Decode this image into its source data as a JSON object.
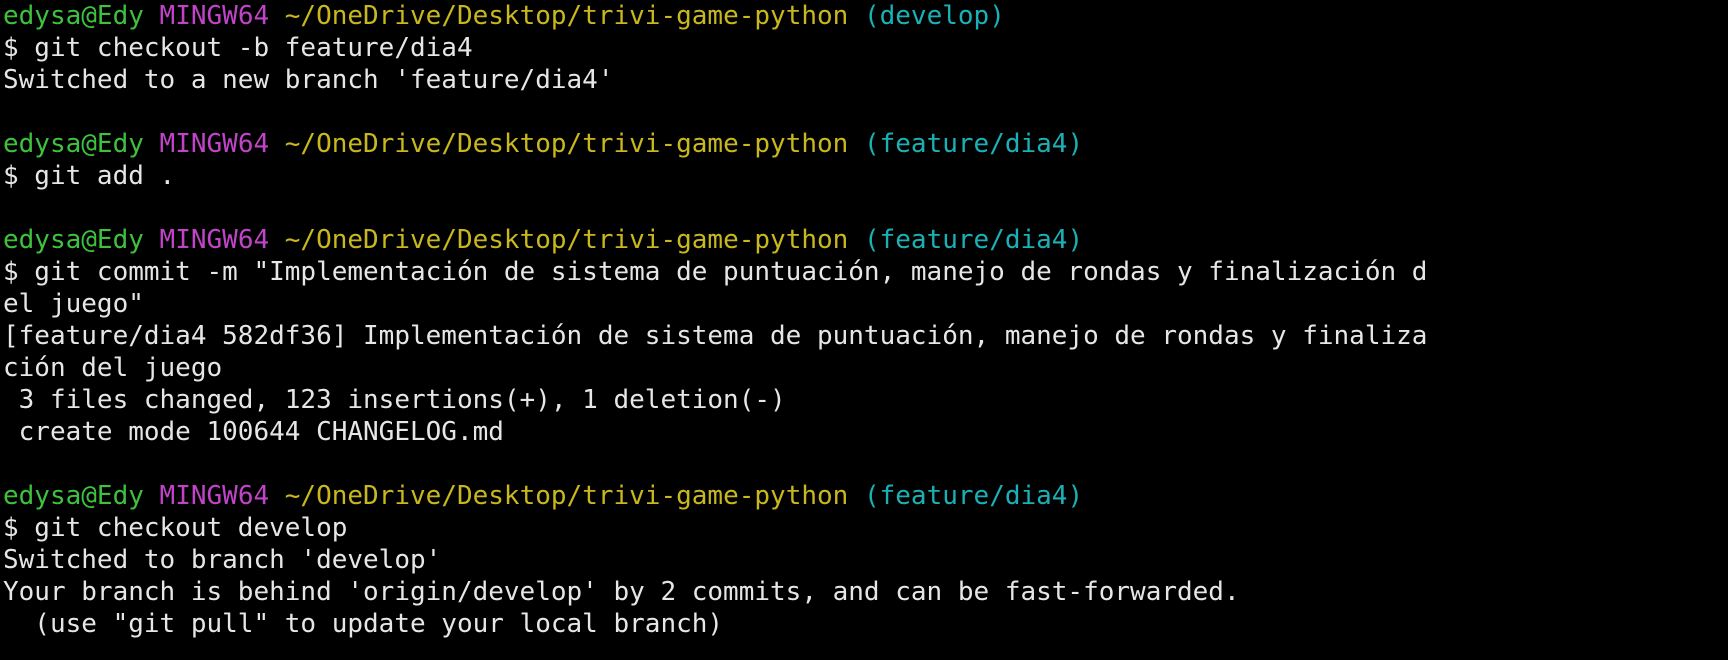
{
  "colors": {
    "background": "#000000",
    "text": "#e6e6e6",
    "user": "#3ec23e",
    "host": "#c044c8",
    "path": "#c8b81e",
    "branch": "#1ab1b6"
  },
  "blocks": [
    {
      "prompt": {
        "user": "edysa@Edy",
        "host": "MINGW64",
        "path": "~/OneDrive/Desktop/trivi-game-python",
        "branch": "(develop)"
      },
      "lines": [
        "$ git checkout -b feature/dia4",
        "Switched to a new branch 'feature/dia4'",
        ""
      ]
    },
    {
      "prompt": {
        "user": "edysa@Edy",
        "host": "MINGW64",
        "path": "~/OneDrive/Desktop/trivi-game-python",
        "branch": "(feature/dia4)"
      },
      "lines": [
        "$ git add .",
        ""
      ]
    },
    {
      "prompt": {
        "user": "edysa@Edy",
        "host": "MINGW64",
        "path": "~/OneDrive/Desktop/trivi-game-python",
        "branch": "(feature/dia4)"
      },
      "lines": [
        "$ git commit -m \"Implementación de sistema de puntuación, manejo de rondas y finalización d",
        "el juego\"",
        "[feature/dia4 582df36] Implementación de sistema de puntuación, manejo de rondas y finaliza",
        "ción del juego",
        " 3 files changed, 123 insertions(+), 1 deletion(-)",
        " create mode 100644 CHANGELOG.md",
        ""
      ]
    },
    {
      "prompt": {
        "user": "edysa@Edy",
        "host": "MINGW64",
        "path": "~/OneDrive/Desktop/trivi-game-python",
        "branch": "(feature/dia4)"
      },
      "lines": [
        "$ git checkout develop",
        "Switched to branch 'develop'",
        "Your branch is behind 'origin/develop' by 2 commits, and can be fast-forwarded.",
        "  (use \"git pull\" to update your local branch)"
      ]
    }
  ]
}
